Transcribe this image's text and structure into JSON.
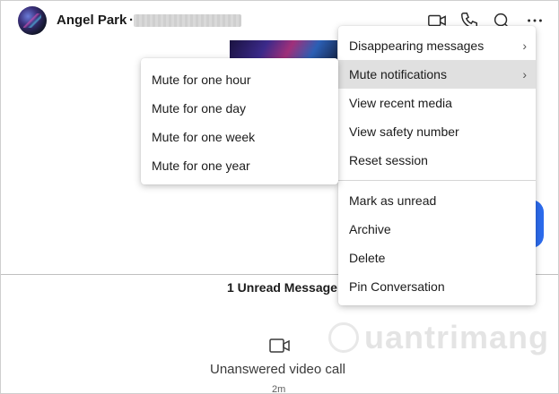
{
  "header": {
    "contact_name": "Angel Park",
    "name_separator": "·",
    "icons": [
      "video-call-icon",
      "phone-icon",
      "search-icon",
      "more-options-icon"
    ]
  },
  "conversation": {
    "unread_label": "1 Unread Message",
    "call_label": "Unanswered video call",
    "call_time": "2m"
  },
  "watermark": {
    "text": "uantrimang"
  },
  "main_menu": {
    "items": [
      {
        "label": "Disappearing messages",
        "submenu": true
      },
      {
        "label": "Mute notifications",
        "submenu": true,
        "active": true
      },
      {
        "label": "View recent media"
      },
      {
        "label": "View safety number"
      },
      {
        "label": "Reset session"
      },
      {
        "label": "Mark as unread"
      },
      {
        "label": "Archive"
      },
      {
        "label": "Delete"
      },
      {
        "label": "Pin Conversation"
      }
    ],
    "chevron": "›"
  },
  "mute_submenu": {
    "items": [
      {
        "label": "Mute for one hour"
      },
      {
        "label": "Mute for one day"
      },
      {
        "label": "Mute for one week"
      },
      {
        "label": "Mute for one year"
      }
    ]
  },
  "colors": {
    "accent_blue": "#2c6bed",
    "menu_hover": "#e0e0e0"
  }
}
